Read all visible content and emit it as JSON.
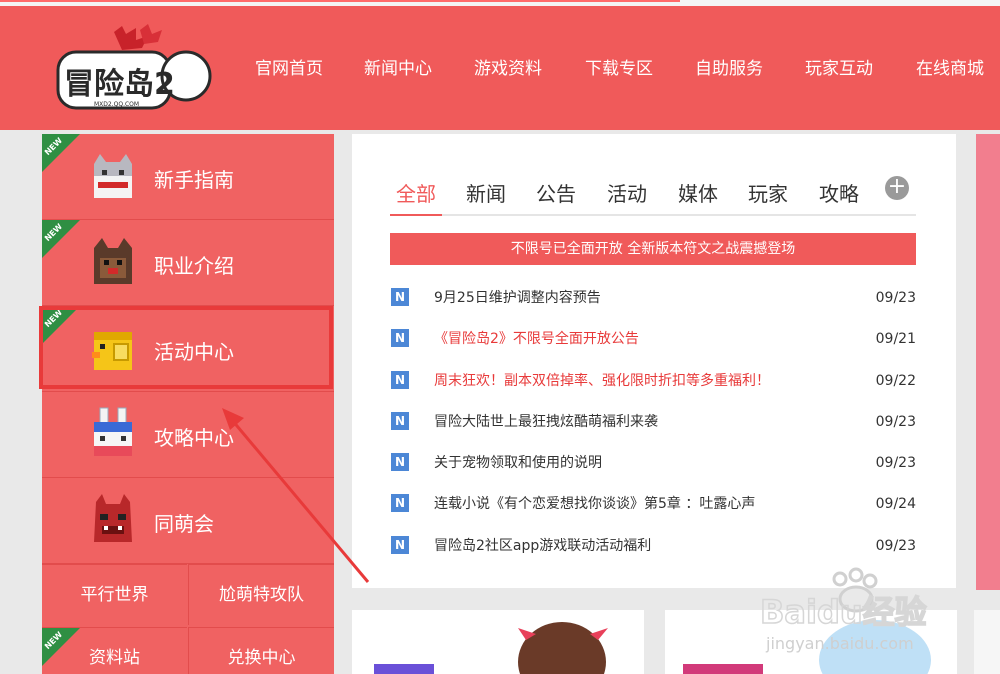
{
  "header": {
    "logo_alt": "冒险岛2",
    "logo_text": "冒险岛2",
    "logo_sub": "MXD2.QQ.COM",
    "nav": [
      "官网首页",
      "新闻中心",
      "游戏资料",
      "下载专区",
      "自助服务",
      "玩家互动",
      "在线商城"
    ]
  },
  "sidebar": {
    "new_badge": "NEW",
    "items": [
      {
        "label": "新手指南",
        "icon": "cat-block-icon",
        "new": true
      },
      {
        "label": "职业介绍",
        "icon": "dog-block-icon",
        "new": true
      },
      {
        "label": "活动中心",
        "icon": "yellow-chick-block-icon",
        "new": true
      },
      {
        "label": "攻略中心",
        "icon": "rabbit-block-icon",
        "new": false
      },
      {
        "label": "同萌会",
        "icon": "red-monster-block-icon",
        "new": false
      }
    ],
    "grid": [
      "平行世界",
      "尬萌特攻队",
      "资料站",
      "兑换中心"
    ]
  },
  "news": {
    "tabs": [
      "全部",
      "新闻",
      "公告",
      "活动",
      "媒体",
      "玩家",
      "攻略"
    ],
    "active_tab": "全部",
    "more": "+",
    "banner": "不限号已全面开放 全新版本符文之战震撼登场",
    "item_icon_letter": "N",
    "items": [
      {
        "title": "9月25日维护调整内容预告",
        "date": "09/23",
        "highlight": false
      },
      {
        "title": "《冒险岛2》不限号全面开放公告",
        "date": "09/21",
        "highlight": true
      },
      {
        "title": "周末狂欢！副本双倍掉率、强化限时折扣等多重福利！",
        "date": "09/22",
        "highlight": true
      },
      {
        "title": "冒险大陆世上最狂拽炫酷萌福利来袭",
        "date": "09/23",
        "highlight": false
      },
      {
        "title": "关于宠物领取和使用的说明",
        "date": "09/23",
        "highlight": false
      },
      {
        "title": "连载小说《有个恋爱想找你谈谈》第5章 ：吐露心声",
        "date": "09/24",
        "highlight": false
      },
      {
        "title": "冒险岛2社区app游戏联动活动福利",
        "date": "09/23",
        "highlight": false
      }
    ]
  },
  "watermark": {
    "brand": "Baidu经验",
    "url": "jingyan.baidu.com"
  },
  "colors": {
    "brand_red": "#f05a5a",
    "highlight_red": "#e83a3a",
    "new_green": "#2f8f43",
    "news_icon_blue": "#4c87d6"
  }
}
